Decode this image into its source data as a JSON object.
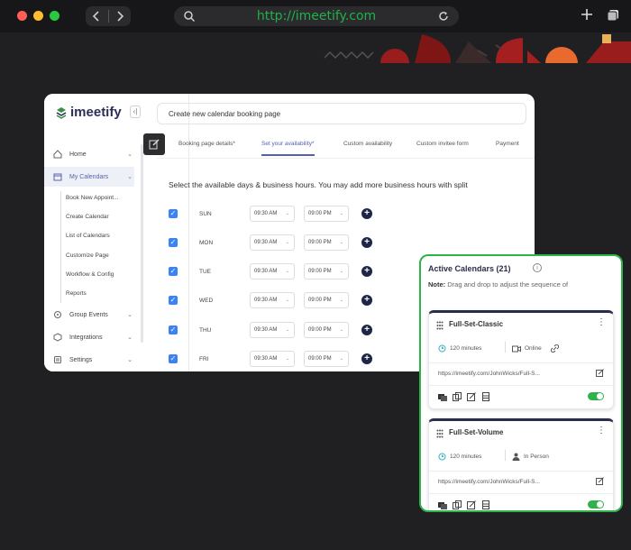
{
  "browser": {
    "url": "http://imeetify.com",
    "colors": {
      "close": "#ff5f57",
      "minimize": "#febc2e",
      "maximize": "#28c840",
      "url_text": "#22b04b"
    }
  },
  "app": {
    "logo": "imeetify",
    "title_bar": "Create new calendar booking page",
    "sidebar": {
      "items": [
        {
          "label": "Home",
          "icon": "home-icon"
        },
        {
          "label": "My Calendars",
          "icon": "calendar-icon"
        },
        {
          "label": "Group Events",
          "icon": "group-icon"
        },
        {
          "label": "Integrations",
          "icon": "puzzle-icon"
        },
        {
          "label": "Settings",
          "icon": "gear-icon"
        }
      ],
      "subitems": [
        "Book New Appoint...",
        "Create Calendar",
        "List of Calendars",
        "Customize Page",
        "Workflow & Config",
        "Reports"
      ]
    },
    "tabs": [
      "Booking page details*",
      "Set your availability*",
      "Custom availability",
      "Custom invitee form",
      "Payment"
    ],
    "active_tab": "Set your availability*",
    "instruction": "Select the available days & business hours. You may add more business hours with split",
    "days": [
      {
        "day": "SUN",
        "start": "09:30 AM",
        "end": "09:00 PM",
        "checked": true
      },
      {
        "day": "MON",
        "start": "09:30 AM",
        "end": "09:00 PM",
        "checked": true
      },
      {
        "day": "TUE",
        "start": "09:30 AM",
        "end": "09:00 PM",
        "checked": true
      },
      {
        "day": "WED",
        "start": "09:30 AM",
        "end": "09:00 PM",
        "checked": true
      },
      {
        "day": "THU",
        "start": "09:30 AM",
        "end": "09:00 PM",
        "checked": true
      },
      {
        "day": "FRI",
        "start": "09:30 AM",
        "end": "09:00 PM",
        "checked": true
      }
    ]
  },
  "panel": {
    "title": "Active Calendars (21)",
    "note_label": "Note:",
    "note_text": "Drag and drop to adjust the sequence of",
    "accent": "#2fb24a",
    "events": [
      {
        "name": "Full-Set-Classic",
        "duration": "120 minutes",
        "location": "Online",
        "url": "https://imeetify.com/JohnWicks/Full-S...",
        "enabled": true
      },
      {
        "name": "Full-Set-Volume",
        "duration": "120 minutes",
        "location": "In Person",
        "url": "https://imeetify.com/JohnWicks/Full-S...",
        "enabled": true
      }
    ]
  }
}
